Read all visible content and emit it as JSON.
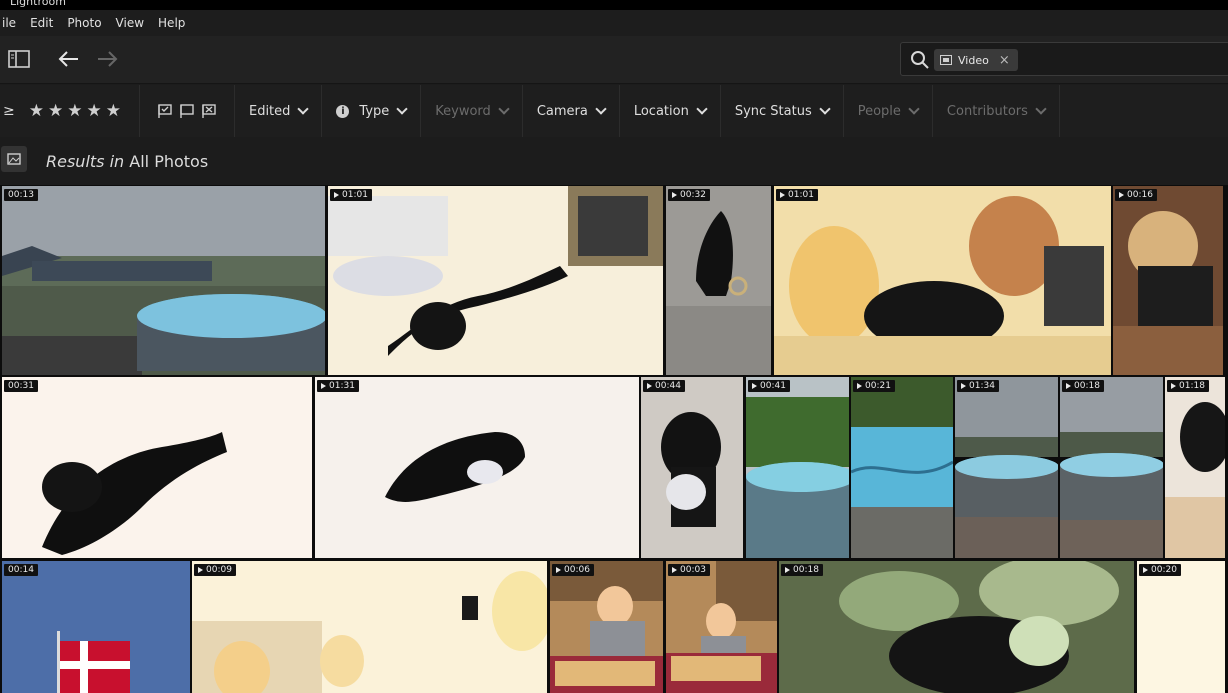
{
  "app": {
    "title": "Lightroom"
  },
  "menu": [
    "ile",
    "Edit",
    "Photo",
    "View",
    "Help"
  ],
  "search": {
    "chip_label": "Video",
    "chip_close": "×"
  },
  "filters": {
    "rating_op": "≥",
    "stars": [
      "★",
      "★",
      "★",
      "★",
      "★"
    ],
    "edited": "Edited",
    "type": "Type",
    "keyword": "Keyword",
    "camera": "Camera",
    "location": "Location",
    "sync_status": "Sync Status",
    "people": "People",
    "contributors": "Contributors"
  },
  "results": {
    "prefix": "Results in",
    "album": "All Photos"
  },
  "thumbnails": [
    {
      "duration": "00:13",
      "scene": "pool-garden"
    },
    {
      "duration": "01:01",
      "scene": "puppy-bright",
      "selected": true
    },
    {
      "duration": "00:32",
      "scene": "puppy-floor"
    },
    {
      "duration": "01:01",
      "scene": "girls-dog"
    },
    {
      "duration": "00:16",
      "scene": "girl-floor"
    },
    {
      "duration": "00:31",
      "scene": "puppy-white"
    },
    {
      "duration": "01:31",
      "scene": "puppy-toy-white"
    },
    {
      "duration": "00:44",
      "scene": "puppy-toy"
    },
    {
      "duration": "00:41",
      "scene": "pool-hedge"
    },
    {
      "duration": "00:21",
      "scene": "pool-water"
    },
    {
      "duration": "01:34",
      "scene": "pool-wide"
    },
    {
      "duration": "00:18",
      "scene": "pool-wide-2"
    },
    {
      "duration": "01:18",
      "scene": "dog-closeup"
    },
    {
      "duration": "00:14",
      "scene": "flag"
    },
    {
      "duration": "00:09",
      "scene": "room-bright"
    },
    {
      "duration": "00:06",
      "scene": "child-cake"
    },
    {
      "duration": "00:03",
      "scene": "child-cake-2"
    },
    {
      "duration": "00:18",
      "scene": "dog-leaves"
    },
    {
      "duration": "00:20",
      "scene": "bright"
    }
  ]
}
